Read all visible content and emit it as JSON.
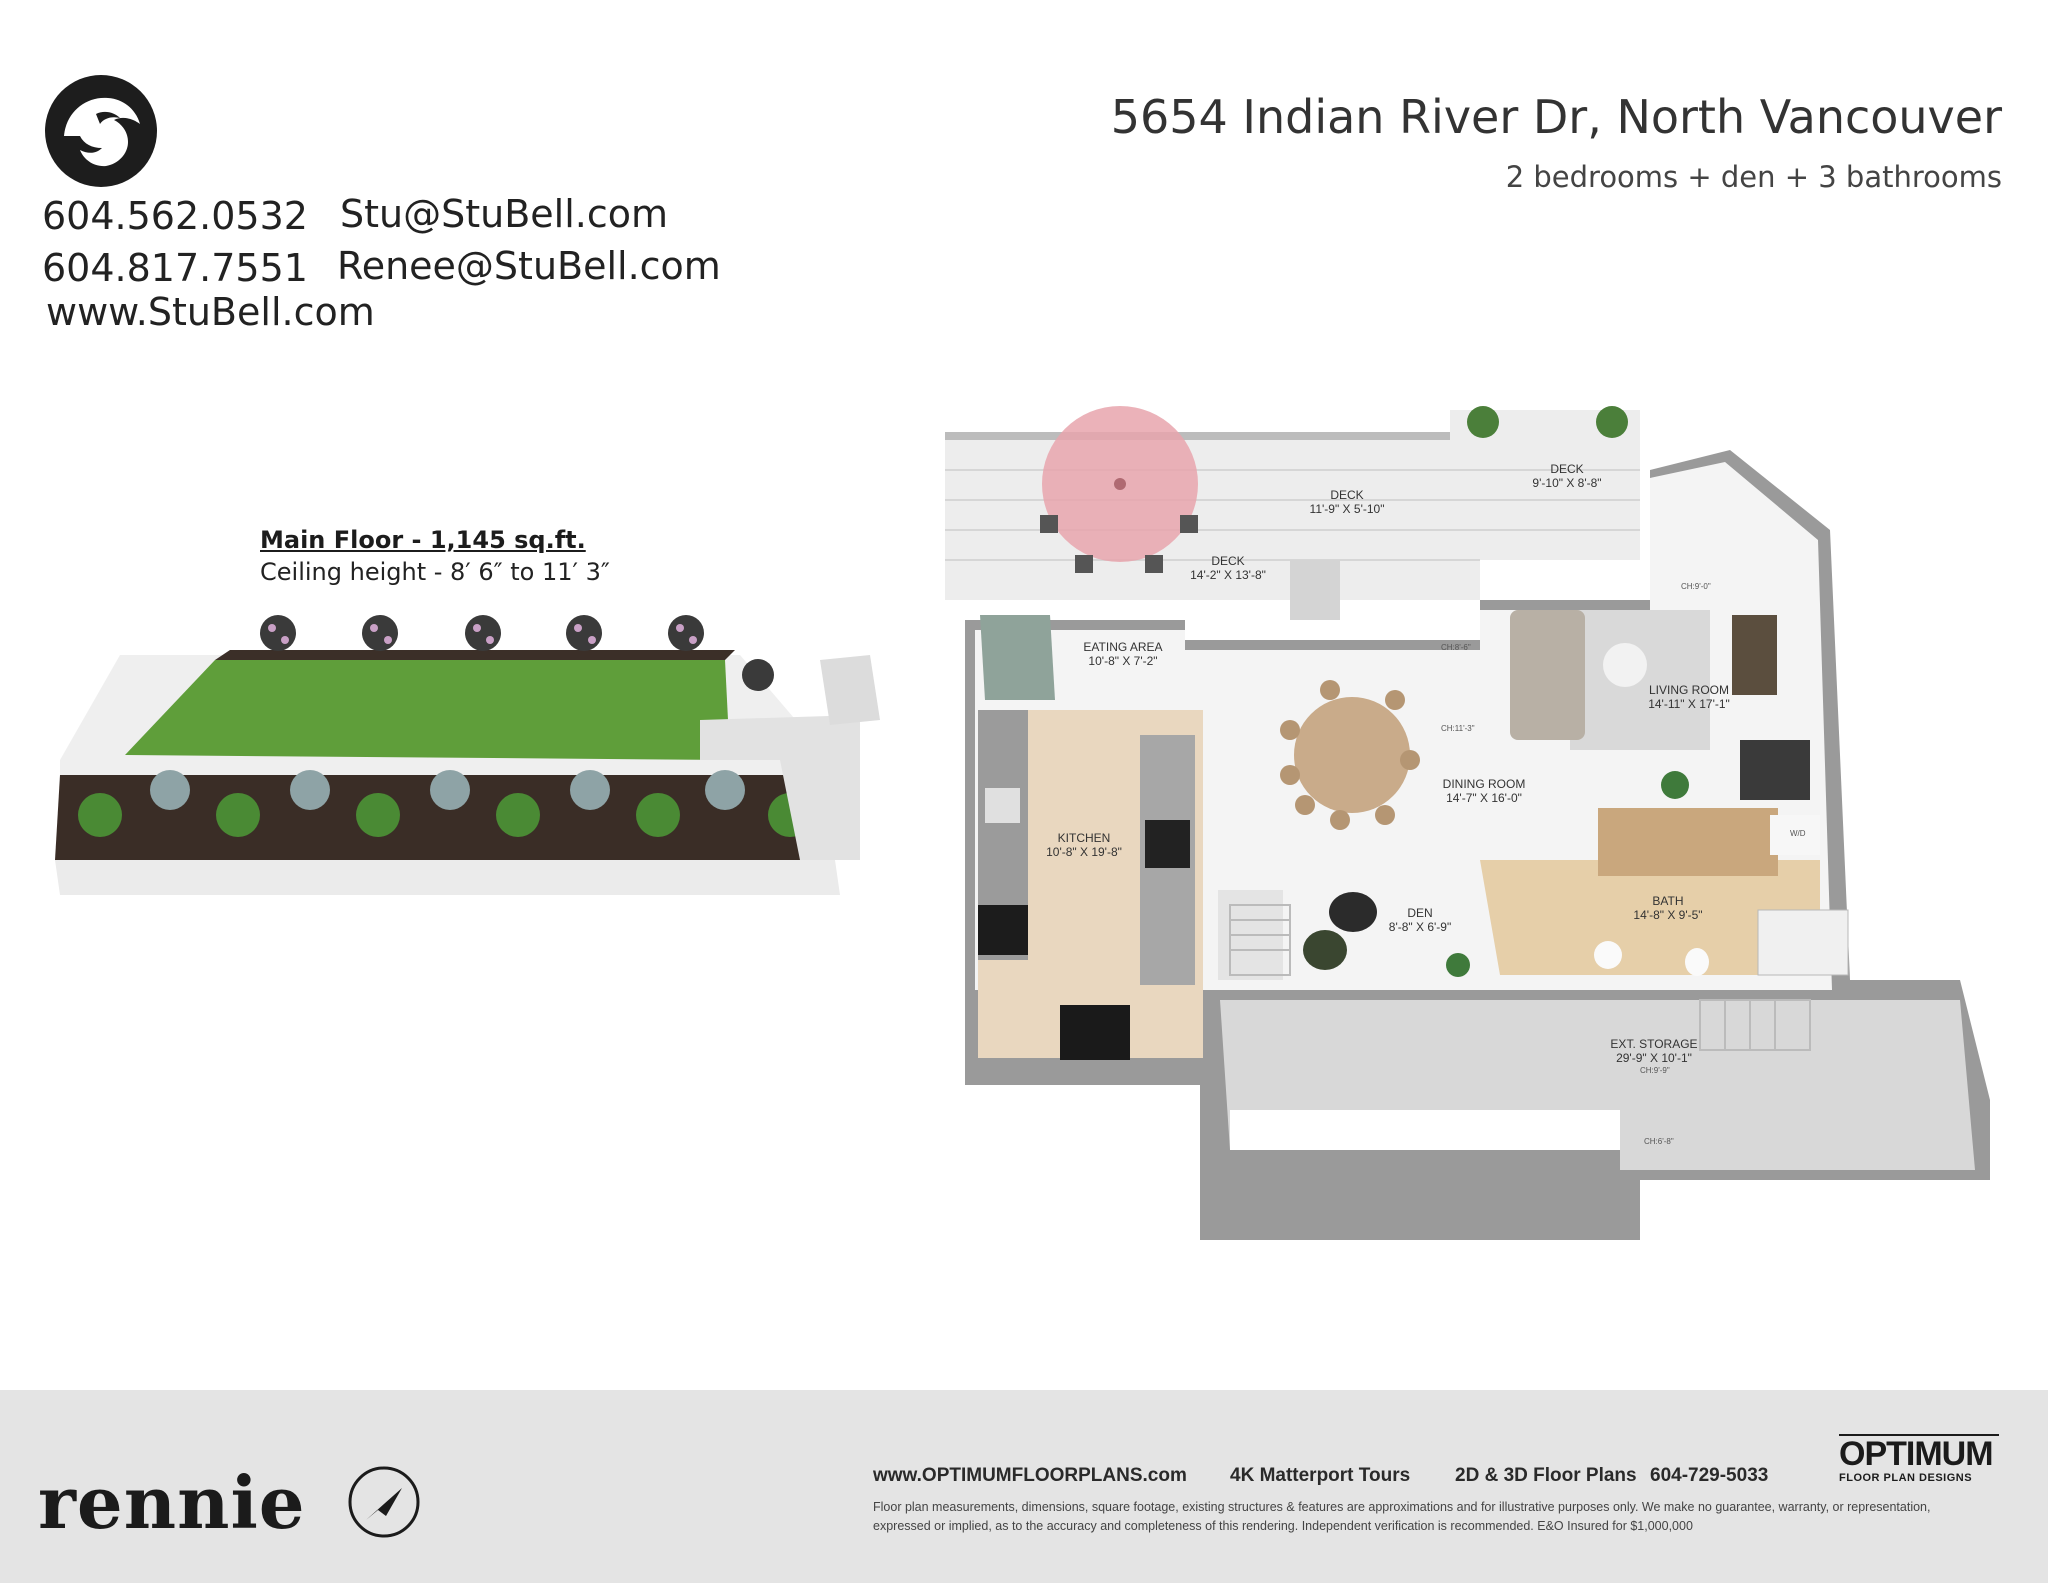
{
  "header": {
    "address": "5654 Indian River Dr, North Vancouver",
    "summary": "2 bedrooms + den + 3 bathrooms",
    "logo_icon": "lion-head-icon"
  },
  "contacts": {
    "phone1": "604.562.0532",
    "email1": "Stu@StuBell.com",
    "phone2": "604.817.7551",
    "email2": "Renee@StuBell.com",
    "website": "www.StuBell.com"
  },
  "floor": {
    "title": "Main Floor - 1,145 sq.ft.",
    "ceiling": "Ceiling height - 8′ 6″ to 11′ 3″"
  },
  "rooms": {
    "deck_upper_left": {
      "name": "DECK",
      "dims": "11'-9\" X 5'-10\""
    },
    "deck_upper_right": {
      "name": "DECK",
      "dims": "9'-10\" X 8'-8\""
    },
    "deck_lower": {
      "name": "DECK",
      "dims": "14'-2\" X 13'-8\""
    },
    "eating": {
      "name": "EATING AREA",
      "dims": "10'-8\" X 7'-2\""
    },
    "kitchen": {
      "name": "KITCHEN",
      "dims": "10'-8\" X 19'-8\""
    },
    "dining": {
      "name": "DINING ROOM",
      "dims": "14'-7\" X 16'-0\""
    },
    "living": {
      "name": "LIVING ROOM",
      "dims": "14'-11\" X 17'-1\""
    },
    "den": {
      "name": "DEN",
      "dims": "8'-8\" X 6'-9\""
    },
    "bath": {
      "name": "BATH",
      "dims": "14'-8\" X 9'-5\""
    },
    "storage": {
      "name": "EXT. STORAGE",
      "dims": "29'-9\" X 10'-1\""
    }
  },
  "ceiling_marks": {
    "living": "CH:9'-0\"",
    "dining_top": "CH:8'-6\"",
    "dining_mid": "CH:11'-3\"",
    "storage": "CH:9'-9\"",
    "storage_low": "CH:6'-8\"",
    "washer": "W/D"
  },
  "footer": {
    "brand": "rennie",
    "compass_icon": "north-arrow-icon",
    "website": "www.OPTIMUMFLOORPLANS.com",
    "tours": "4K Matterport Tours",
    "plans": "2D & 3D Floor Plans",
    "phone": "604-729-5033",
    "optimum_logo": "OPTIMUM",
    "optimum_sub": "FLOOR PLAN DESIGNS",
    "disclaimer": "Floor plan measurements, dimensions, square footage, existing structures & features are approximations and for illustrative purposes only. We make no guarantee, warranty, or representation, expressed or implied, as to the accuracy and completeness of this rendering. Independent verification is recommended. E&O Insured for $1,000,000"
  }
}
